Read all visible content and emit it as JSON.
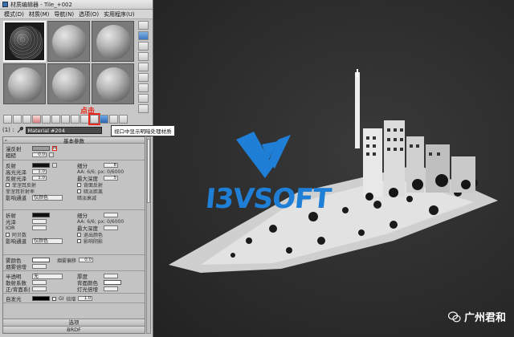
{
  "window": {
    "title": "材质编辑器 - Tile_+002"
  },
  "menu": [
    "模式(D)",
    "材质(M)",
    "导航(N)",
    "选项(O)",
    "实用程序(U)"
  ],
  "annotation": {
    "click_label": "点击"
  },
  "tooltip": "视口中显示明暗处理材质",
  "material": {
    "slot_label": "(1) :",
    "name": "Material #204"
  },
  "rollout_basic": {
    "header": "基本参数",
    "diffuse": "漫反射",
    "roughness": "粗糙",
    "roughness_val": "0.0",
    "map_m": "M"
  },
  "reflect": {
    "label": "反射",
    "gloss": "高光光泽",
    "gloss_val": "1.0",
    "refl_gloss": "反射光泽",
    "refl_gloss_val": "1.0",
    "fresnel": "菲涅耳反射",
    "fresnel_ior": "菲涅耳折射率",
    "exit": "影响通道",
    "exit_val": "仅颜色",
    "subdivs": "细分",
    "subdivs_val": "8",
    "aa": "AA: 6/6; px: 0/6000",
    "max_depth": "最大深度",
    "max_depth_val": "5",
    "back_refl": "背面反射",
    "dim_dist": "暗淡距离",
    "dim_falloff": "暗淡衰减"
  },
  "refract": {
    "label": "折射",
    "gloss": "光泽",
    "ior": "IOR",
    "abbe": "阿贝数",
    "affect": "影响通道",
    "affect_val": "仅颜色",
    "subdivs": "细分",
    "max_depth": "最大深度",
    "exit_color": "退出颜色",
    "affect_shadows": "影响阴影",
    "aa": "AA: 6/6; px: 0/6000"
  },
  "fog": {
    "color": "雾颜色",
    "mult": "烟雾倍增",
    "bias": "烟雾偏移",
    "bias_val": "0.0"
  },
  "translucency": {
    "label": "半透明",
    "type": "无",
    "scatter": "散射系数",
    "fwd": "正/背面系数",
    "thickness": "厚度",
    "back_color": "背面颜色",
    "light_mult": "灯光倍增"
  },
  "self_illum": {
    "label": "自发光",
    "gi": "GI",
    "mult": "倍增",
    "mult_val": "1.0"
  },
  "rollout_footer": {
    "options": "选项",
    "brdf": "BRDF"
  },
  "logo": {
    "text": "I3VSOFT"
  },
  "watermark": {
    "text": "广州君和"
  },
  "colors": {
    "accent_red": "#e8281c",
    "logo_blue": "#1f7fd6"
  }
}
